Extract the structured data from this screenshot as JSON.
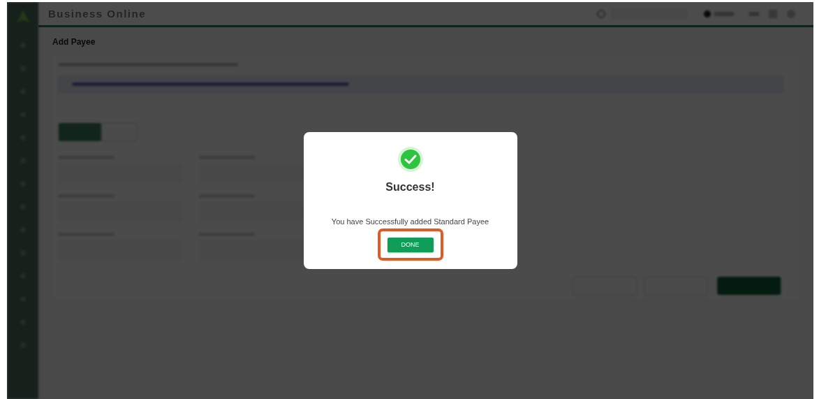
{
  "app": {
    "title": "Business Online"
  },
  "page": {
    "title": "Add Payee"
  },
  "dialog": {
    "title": "Success!",
    "message": "You have Successfully added Standard Payee",
    "button": {
      "label": "DONE",
      "highlighted": true
    }
  }
}
